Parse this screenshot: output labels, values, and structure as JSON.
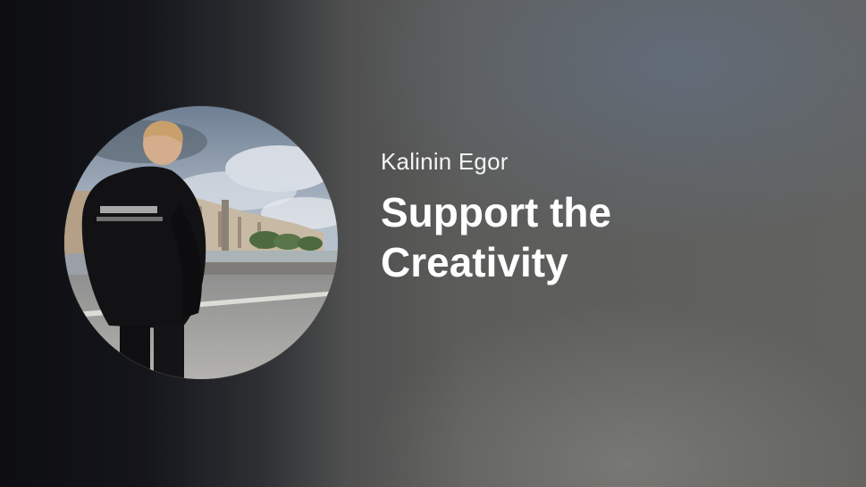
{
  "profile": {
    "author_name": "Kalinin Egor",
    "headline": "Support the Creativity",
    "avatar_icon": "profile-photo"
  },
  "colors": {
    "background_dark": "#0d0e12",
    "background_light": "#62625f",
    "text": "#ffffff"
  }
}
